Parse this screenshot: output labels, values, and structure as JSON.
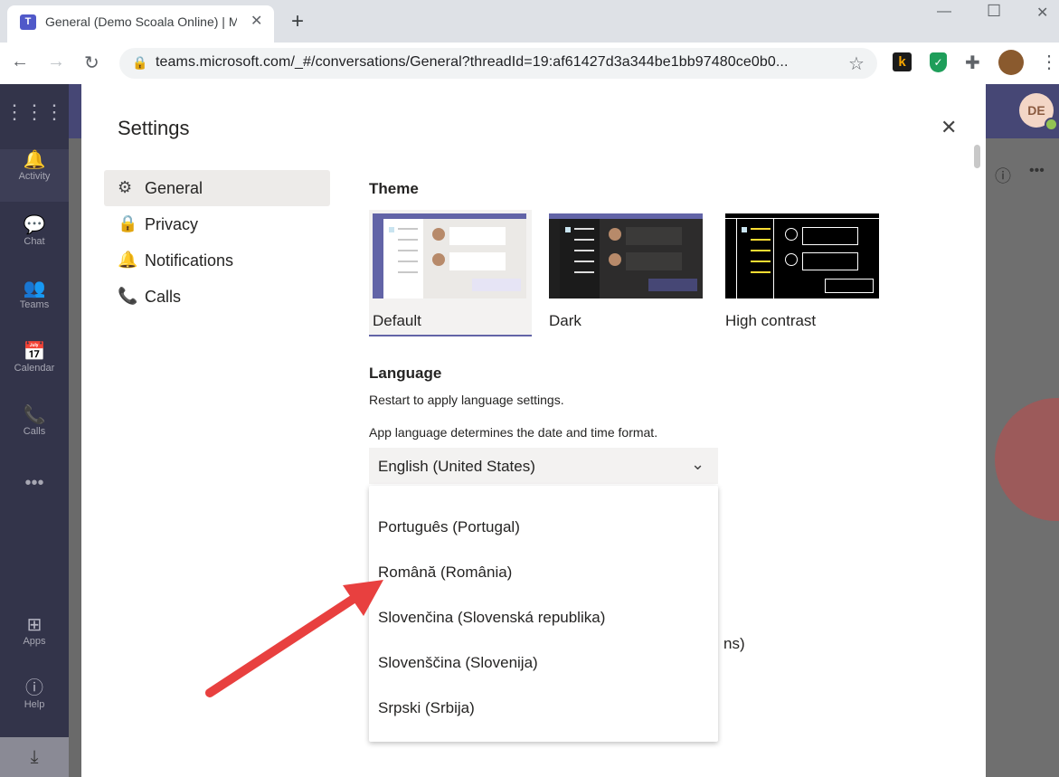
{
  "browser": {
    "tab_title": "General (Demo Scoala Online) | M",
    "url": "teams.microsoft.com/_#/conversations/General?threadId=19:af61427d3a344be1bb97480ce0b0..."
  },
  "rail": {
    "items": [
      {
        "label": "Activity"
      },
      {
        "label": "Chat"
      },
      {
        "label": "Teams"
      },
      {
        "label": "Calendar"
      },
      {
        "label": "Calls"
      },
      {
        "label": "Apps"
      },
      {
        "label": "Help"
      }
    ]
  },
  "header": {
    "avatar_initials": "DE"
  },
  "settings": {
    "title": "Settings",
    "nav": [
      {
        "label": "General"
      },
      {
        "label": "Privacy"
      },
      {
        "label": "Notifications"
      },
      {
        "label": "Calls"
      }
    ],
    "theme": {
      "heading": "Theme",
      "options": [
        {
          "label": "Default"
        },
        {
          "label": "Dark"
        },
        {
          "label": "High contrast"
        }
      ]
    },
    "language": {
      "heading": "Language",
      "restart_note": "Restart to apply language settings.",
      "app_language_note": "App language determines the date and time format.",
      "selected": "English (United States)",
      "options": [
        "Português (Portugal)",
        "Română (România)",
        "Slovenčina (Slovenská republika)",
        "Slovenščina (Slovenija)",
        "Srpski (Srbija)"
      ],
      "hidden_text_fragment": "ns)"
    }
  },
  "colors": {
    "teams_purple": "#464775",
    "accent": "#6264a7",
    "arrow": "#e8403f"
  }
}
